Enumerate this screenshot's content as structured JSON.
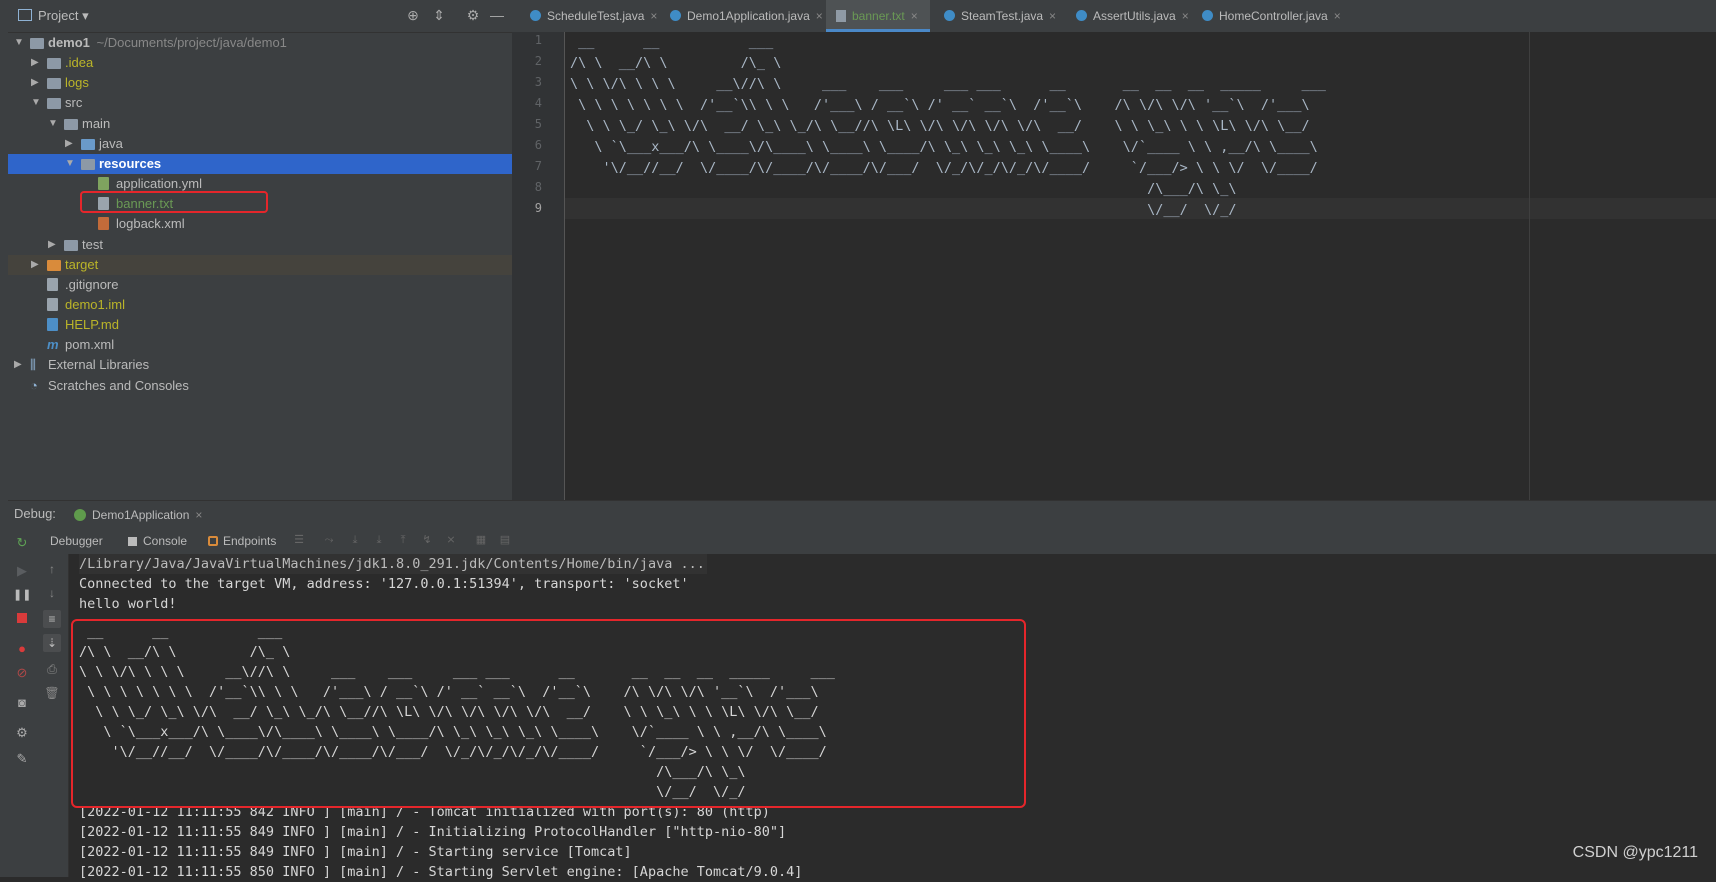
{
  "project": {
    "title": "Project",
    "tree": [
      {
        "label": "demo1",
        "path": "~/Documents/project/java/demo1",
        "depth": 0,
        "expanded": true,
        "kind": "folder-gray"
      },
      {
        "label": ".idea",
        "depth": 1,
        "expanded": false,
        "kind": "folder-gray",
        "color": "yellow"
      },
      {
        "label": "logs",
        "depth": 1,
        "expanded": false,
        "kind": "folder-gray",
        "color": "yellow"
      },
      {
        "label": "src",
        "depth": 1,
        "expanded": true,
        "kind": "folder-gray"
      },
      {
        "label": "main",
        "depth": 2,
        "expanded": true,
        "kind": "folder-gray"
      },
      {
        "label": "java",
        "depth": 3,
        "expanded": false,
        "kind": "folder-blue"
      },
      {
        "label": "resources",
        "depth": 3,
        "expanded": true,
        "kind": "folder-gray",
        "selected": true
      },
      {
        "label": "application.yml",
        "depth": 4,
        "kind": "file-yml"
      },
      {
        "label": "banner.txt",
        "depth": 4,
        "kind": "file-txt",
        "color": "green"
      },
      {
        "label": "logback.xml",
        "depth": 4,
        "kind": "file-xml"
      },
      {
        "label": "test",
        "depth": 2,
        "expanded": false,
        "kind": "folder-gray"
      },
      {
        "label": "target",
        "depth": 1,
        "expanded": false,
        "kind": "folder-orange",
        "color": "yellow"
      },
      {
        "label": ".gitignore",
        "depth": 1,
        "kind": "file-txt"
      },
      {
        "label": "demo1.iml",
        "depth": 1,
        "kind": "file-txt",
        "color": "yellow"
      },
      {
        "label": "HELP.md",
        "depth": 1,
        "kind": "file-md",
        "color": "yellow"
      },
      {
        "label": "pom.xml",
        "depth": 1,
        "kind": "file-pom"
      },
      {
        "label": "External Libraries",
        "depth": 0,
        "expanded": false,
        "kind": "library"
      },
      {
        "label": "Scratches and Consoles",
        "depth": 0,
        "kind": "scratch"
      }
    ]
  },
  "editor": {
    "tabs": [
      {
        "label": "ScheduleTest.java",
        "kind": "class"
      },
      {
        "label": "Demo1Application.java",
        "kind": "class"
      },
      {
        "label": "banner.txt",
        "kind": "text",
        "active": true
      },
      {
        "label": "SteamTest.java",
        "kind": "class"
      },
      {
        "label": "AssertUtils.java",
        "kind": "class"
      },
      {
        "label": "HomeController.java",
        "kind": "class"
      }
    ],
    "line_numbers": [
      "1",
      "2",
      "3",
      "4",
      "5",
      "6",
      "7",
      "8",
      "9"
    ],
    "banner_lines": [
      " __      __           ___",
      "/\\ \\  __/\\ \\         /\\_ \\",
      "\\ \\ \\/\\ \\ \\ \\     __\\//\\ \\     ___    ___     ___ ___      __       __  __  __  _____     ___",
      " \\ \\ \\ \\ \\ \\ \\  /'__`\\\\ \\ \\   /'___\\ / __`\\ /' __` __`\\  /'__`\\    /\\ \\/\\ \\/\\ '__`\\  /'___\\",
      "  \\ \\ \\_/ \\_\\ \\/\\  __/ \\_\\ \\_/\\ \\__//\\ \\L\\ \\/\\ \\/\\ \\/\\ \\/\\  __/    \\ \\ \\_\\ \\ \\ \\L\\ \\/\\ \\__/",
      "   \\ `\\___x___/\\ \\____\\/\\____\\ \\____\\ \\____/\\ \\_\\ \\_\\ \\_\\ \\____\\    \\/`____ \\ \\ ,__/\\ \\____\\",
      "    '\\/__//__/  \\/____/\\/____/\\/____/\\/___/  \\/_/\\/_/\\/_/\\/____/     `/___/> \\ \\ \\/  \\/____/",
      "                                                                       /\\___/\\ \\_\\",
      "                                                                       \\/__/  \\/_/"
    ]
  },
  "debug": {
    "label": "Debug:",
    "run_config": "Demo1Application",
    "tabs": {
      "debugger": "Debugger",
      "console": "Console",
      "endpoints": "Endpoints"
    }
  },
  "console": {
    "command": "/Library/Java/JavaVirtualMachines/jdk1.8.0_291.jdk/Contents/Home/bin/java ...",
    "connected": "Connected to the target VM, address: '127.0.0.1:51394', transport: 'socket'",
    "hello": "hello world!",
    "log_lines": [
      "[2022-01-12 11:11:55 842 INFO ] [main] / - Tomcat initialized with port(s): 80 (http)",
      "[2022-01-12 11:11:55 849 INFO ] [main] / - Initializing ProtocolHandler [\"http-nio-80\"]",
      "[2022-01-12 11:11:55 849 INFO ] [main] / - Starting service [Tomcat]",
      "[2022-01-12 11:11:55 850 INFO ] [main] / - Starting Servlet engine: [Apache Tomcat/9.0.4]"
    ]
  },
  "watermark": "CSDN @ypc1211",
  "colors": {
    "highlight": "#e5262b",
    "selection": "#2f65ca"
  }
}
